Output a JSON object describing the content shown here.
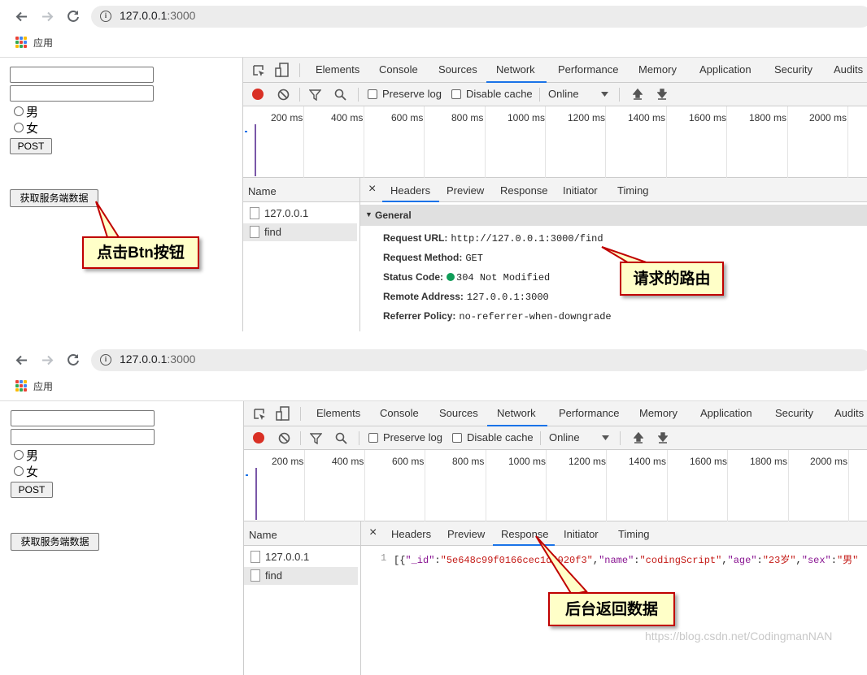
{
  "browser": {
    "url_host": "127.0.0.1",
    "url_port": ":3000",
    "apps_label": "应用"
  },
  "form": {
    "radio_male": "男",
    "radio_female": "女",
    "post_button": "POST",
    "fetch_button": "获取服务端数据"
  },
  "devtools": {
    "tabs": [
      "Elements",
      "Console",
      "Sources",
      "Network",
      "Performance",
      "Memory",
      "Application",
      "Security",
      "Audits"
    ],
    "active_tab": "Network",
    "toolbar": {
      "preserve_log": "Preserve log",
      "disable_cache": "Disable cache",
      "throttle": "Online"
    },
    "timeline_ticks": [
      "200 ms",
      "400 ms",
      "600 ms",
      "800 ms",
      "1000 ms",
      "1200 ms",
      "1400 ms",
      "1600 ms",
      "1800 ms",
      "2000 ms"
    ],
    "name_header": "Name",
    "requests": [
      "127.0.0.1",
      "find"
    ],
    "detail_tabs": [
      "Headers",
      "Preview",
      "Response",
      "Initiator",
      "Timing"
    ],
    "close_glyph": "×"
  },
  "panel1": {
    "active_detail_tab": "Headers",
    "general_label": "General",
    "request_url_label": "Request URL:",
    "request_url": "http://127.0.0.1:3000/find",
    "request_method_label": "Request Method:",
    "request_method": "GET",
    "status_code_label": "Status Code:",
    "status_code": "304 Not Modified",
    "remote_address_label": "Remote Address:",
    "remote_address": "127.0.0.1:3000",
    "referrer_policy_label": "Referrer Policy:",
    "referrer_policy": "no-referrer-when-downgrade",
    "callout_click_pre": "点击",
    "callout_click_bold": "Btn",
    "callout_click_post": "按钮",
    "callout_route": "请求的路由"
  },
  "panel2": {
    "active_detail_tab": "Response",
    "line_number": "1",
    "response": {
      "open": "[{",
      "k_id": "\"_id\"",
      "v_id": "\"5e648c99f0166cec1d4920f3\"",
      "k_name": "\"name\"",
      "v_name": "\"codingScript\"",
      "k_age": "\"age\"",
      "v_age": "\"23岁\"",
      "k_sex": "\"sex\"",
      "v_sex": "\"男\""
    },
    "callout_response": "后台返回数据"
  },
  "watermark": "https://blog.csdn.net/CodingmanNAN",
  "colors": {
    "accent": "#1a73e8",
    "record": "#d93025",
    "status_ok": "#0f9d58",
    "json_key": "#881391",
    "json_string": "#c41a16",
    "callout_bg": "#ffffc8",
    "callout_border": "#c00000"
  }
}
